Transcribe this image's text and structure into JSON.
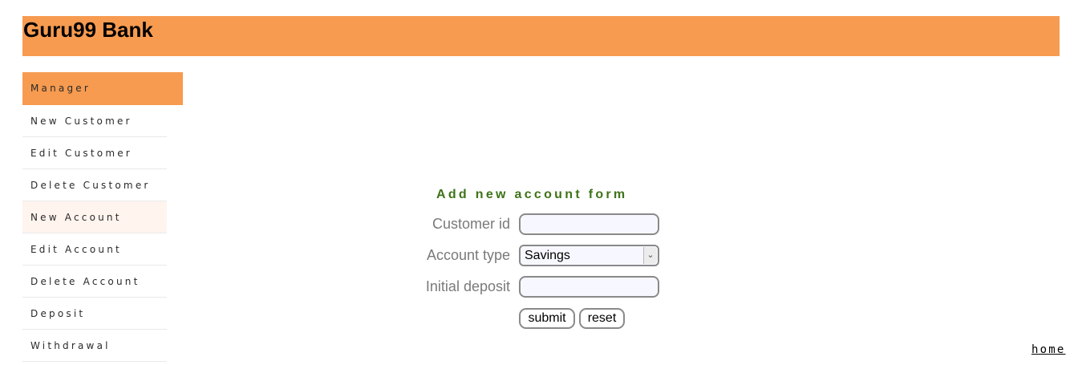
{
  "header": {
    "title": "Guru99 Bank"
  },
  "sidebar": {
    "items": [
      {
        "label": "Manager"
      },
      {
        "label": "New Customer"
      },
      {
        "label": "Edit Customer"
      },
      {
        "label": "Delete Customer"
      },
      {
        "label": "New Account"
      },
      {
        "label": "Edit Account"
      },
      {
        "label": "Delete Account"
      },
      {
        "label": "Deposit"
      },
      {
        "label": "Withdrawal"
      }
    ]
  },
  "form": {
    "title": "Add new account form",
    "customer_id_label": "Customer id",
    "customer_id_value": "",
    "account_type_label": "Account type",
    "account_type_value": "Savings",
    "initial_deposit_label": "Initial deposit",
    "initial_deposit_value": "",
    "submit_label": "submit",
    "reset_label": "reset"
  },
  "footer": {
    "home_link": "home"
  },
  "colors": {
    "accent": "#f79b50",
    "form_title": "#3e7318",
    "label": "#7a7a7a"
  }
}
